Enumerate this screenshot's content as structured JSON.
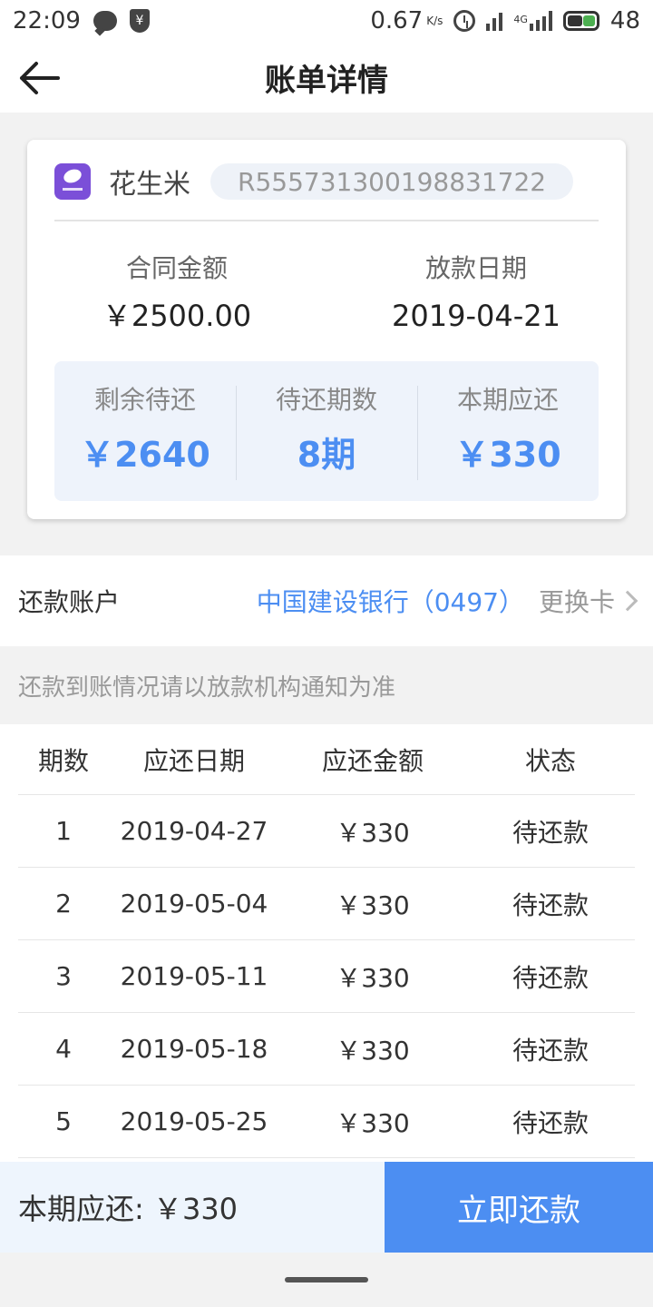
{
  "status_bar": {
    "time": "22:09",
    "shield_glyph": "¥",
    "net_speed": "0.67",
    "net_speed_unit": "K/s",
    "signal_label": "4G",
    "battery": "48"
  },
  "header": {
    "title": "账单详情"
  },
  "card": {
    "brand_name": "花生米",
    "order_no": "R555731300198831722",
    "contract_amount_label": "合同金额",
    "contract_amount": "￥2500.00",
    "loan_date_label": "放款日期",
    "loan_date": "2019-04-21",
    "stats": [
      {
        "label": "剩余待还",
        "value": "￥2640"
      },
      {
        "label": "待还期数",
        "value": "8期"
      },
      {
        "label": "本期应还",
        "value": "￥330"
      }
    ]
  },
  "account": {
    "label": "还款账户",
    "bank": "中国建设银行（0497）",
    "change_label": "更换卡"
  },
  "notice": "还款到账情况请以放款机构通知为准",
  "schedule": {
    "headers": [
      "期数",
      "应还日期",
      "应还金额",
      "状态"
    ],
    "rows": [
      [
        "1",
        "2019-04-27",
        "￥330",
        "待还款"
      ],
      [
        "2",
        "2019-05-04",
        "￥330",
        "待还款"
      ],
      [
        "3",
        "2019-05-11",
        "￥330",
        "待还款"
      ],
      [
        "4",
        "2019-05-18",
        "￥330",
        "待还款"
      ],
      [
        "5",
        "2019-05-25",
        "￥330",
        "待还款"
      ]
    ]
  },
  "bottom": {
    "due_text": "本期应还: ￥330",
    "pay_button": "立即还款"
  },
  "colors": {
    "accent": "#4c8ef2",
    "card_stats_bg": "#eef3fb",
    "page_bg": "#f2f2f2"
  },
  "icons": [
    "back-arrow-icon",
    "chat-icon",
    "shield-icon",
    "alarm-icon",
    "signal-icon",
    "battery-icon",
    "brand-logo-icon",
    "chevron-right-icon"
  ]
}
